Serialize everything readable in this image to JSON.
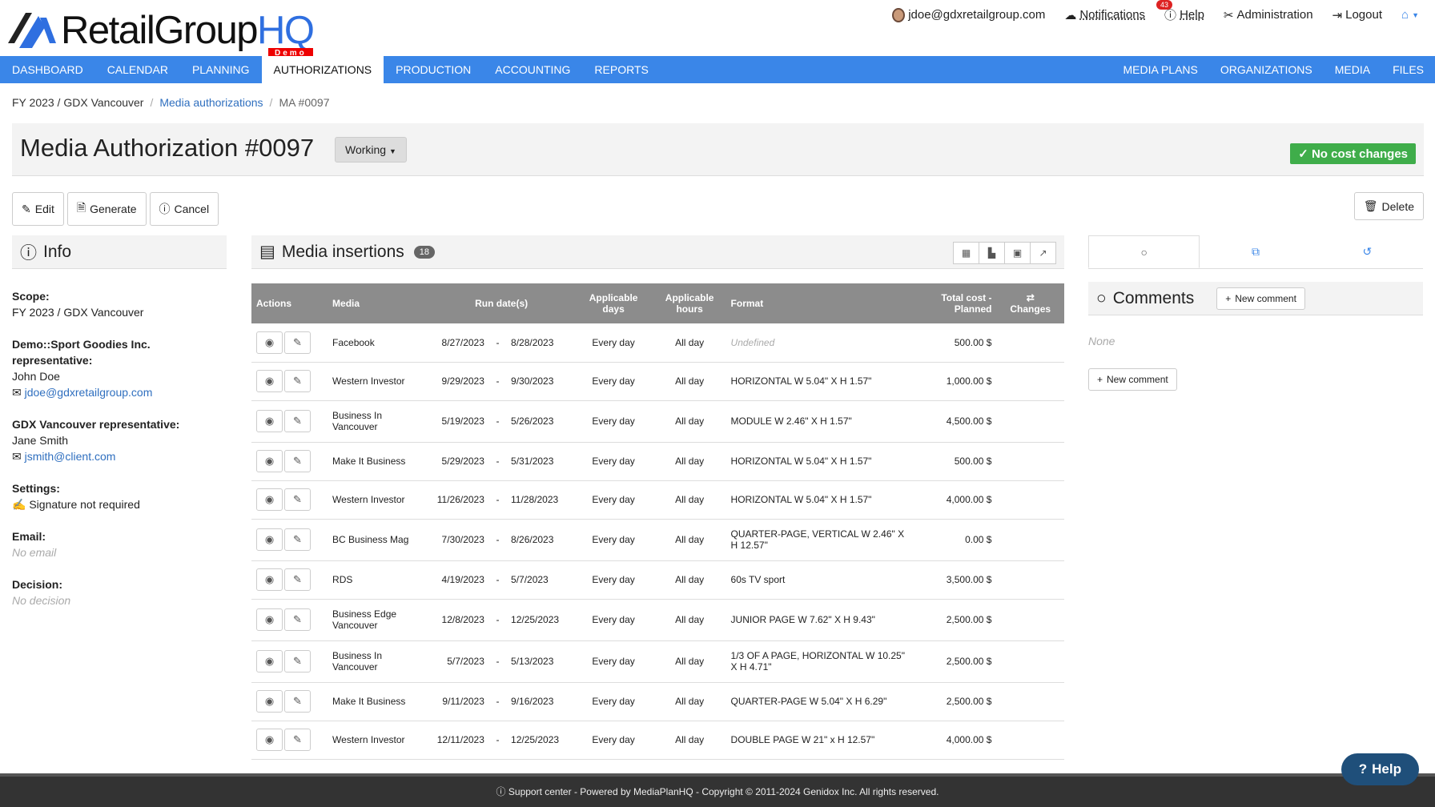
{
  "logo": {
    "text1": "RetailGroup",
    "text2": "HQ",
    "demo": "Demo"
  },
  "usermenu": {
    "email": "jdoe@gdxretailgroup.com",
    "notifications": "Notifications",
    "notifications_count": "43",
    "help": "Help",
    "administration": "Administration",
    "logout": "Logout"
  },
  "nav": {
    "left": [
      "DASHBOARD",
      "CALENDAR",
      "PLANNING",
      "AUTHORIZATIONS",
      "PRODUCTION",
      "ACCOUNTING",
      "REPORTS"
    ],
    "right": [
      "MEDIA PLANS",
      "ORGANIZATIONS",
      "MEDIA",
      "FILES"
    ],
    "active": "AUTHORIZATIONS"
  },
  "breadcrumb": {
    "scope": "FY 2023 / GDX Vancouver",
    "link": "Media authorizations",
    "current": "MA #0097"
  },
  "title": "Media Authorization #0097",
  "status": "Working",
  "nocost": "No cost changes",
  "buttons": {
    "edit": "Edit",
    "generate": "Generate",
    "cancel": "Cancel",
    "delete": "Delete"
  },
  "info": {
    "heading": "Info",
    "scope_label": "Scope:",
    "scope_value": "FY 2023 / GDX Vancouver",
    "client_rep_label": "Demo::Sport Goodies Inc. representative:",
    "client_rep_name": "John Doe",
    "client_rep_email": "jdoe@gdxretailgroup.com",
    "agency_rep_label": "GDX Vancouver representative:",
    "agency_rep_name": "Jane Smith",
    "agency_rep_email": "jsmith@client.com",
    "settings_label": "Settings:",
    "settings_value": "Signature not required",
    "email_label": "Email:",
    "email_value": "No email",
    "decision_label": "Decision:",
    "decision_value": "No decision"
  },
  "insertions": {
    "heading": "Media insertions",
    "count": "18",
    "columns": {
      "actions": "Actions",
      "media": "Media",
      "run": "Run date(s)",
      "days": "Applicable days",
      "hours": "Applicable hours",
      "format": "Format",
      "cost": "Total cost - Planned",
      "changes": "Changes"
    },
    "rows": [
      {
        "media": "Facebook",
        "start": "8/27/2023",
        "end": "8/28/2023",
        "days": "Every day",
        "hours": "All day",
        "format": "Undefined",
        "cost": "500.00 $"
      },
      {
        "media": "Western Investor",
        "start": "9/29/2023",
        "end": "9/30/2023",
        "days": "Every day",
        "hours": "All day",
        "format": "HORIZONTAL W 5.04\" X H 1.57\"",
        "cost": "1,000.00 $"
      },
      {
        "media": "Business In Vancouver",
        "start": "5/19/2023",
        "end": "5/26/2023",
        "days": "Every day",
        "hours": "All day",
        "format": "MODULE W 2.46\" X H 1.57\"",
        "cost": "4,500.00 $"
      },
      {
        "media": "Make It Business",
        "start": "5/29/2023",
        "end": "5/31/2023",
        "days": "Every day",
        "hours": "All day",
        "format": "HORIZONTAL W 5.04\" X H 1.57\"",
        "cost": "500.00 $"
      },
      {
        "media": "Western Investor",
        "start": "11/26/2023",
        "end": "11/28/2023",
        "days": "Every day",
        "hours": "All day",
        "format": "HORIZONTAL W 5.04\" X H 1.57\"",
        "cost": "4,000.00 $"
      },
      {
        "media": "BC Business Mag",
        "start": "7/30/2023",
        "end": "8/26/2023",
        "days": "Every day",
        "hours": "All day",
        "format": "QUARTER-PAGE, VERTICAL W 2.46\" X H 12.57\"",
        "cost": "0.00 $"
      },
      {
        "media": "RDS",
        "start": "4/19/2023",
        "end": "5/7/2023",
        "days": "Every day",
        "hours": "All day",
        "format": "60s TV sport",
        "cost": "3,500.00 $"
      },
      {
        "media": "Business Edge Vancouver",
        "start": "12/8/2023",
        "end": "12/25/2023",
        "days": "Every day",
        "hours": "All day",
        "format": "JUNIOR PAGE W 7.62\" X H 9.43\"",
        "cost": "2,500.00 $"
      },
      {
        "media": "Business In Vancouver",
        "start": "5/7/2023",
        "end": "5/13/2023",
        "days": "Every day",
        "hours": "All day",
        "format": "1/3 OF A PAGE, HORIZONTAL W 10.25\" X H 4.71\"",
        "cost": "2,500.00 $"
      },
      {
        "media": "Make It Business",
        "start": "9/11/2023",
        "end": "9/16/2023",
        "days": "Every day",
        "hours": "All day",
        "format": "QUARTER-PAGE W 5.04\" X H 6.29\"",
        "cost": "2,500.00 $"
      },
      {
        "media": "Western Investor",
        "start": "12/11/2023",
        "end": "12/25/2023",
        "days": "Every day",
        "hours": "All day",
        "format": "DOUBLE PAGE W 21\" x H 12.57\"",
        "cost": "4,000.00 $"
      }
    ]
  },
  "comments": {
    "heading": "Comments",
    "new_comment": "New comment",
    "none": "None"
  },
  "footer": "Support center - Powered by MediaPlanHQ - Copyright © 2011-2024 Genidox Inc. All rights reserved.",
  "help_float": "Help"
}
